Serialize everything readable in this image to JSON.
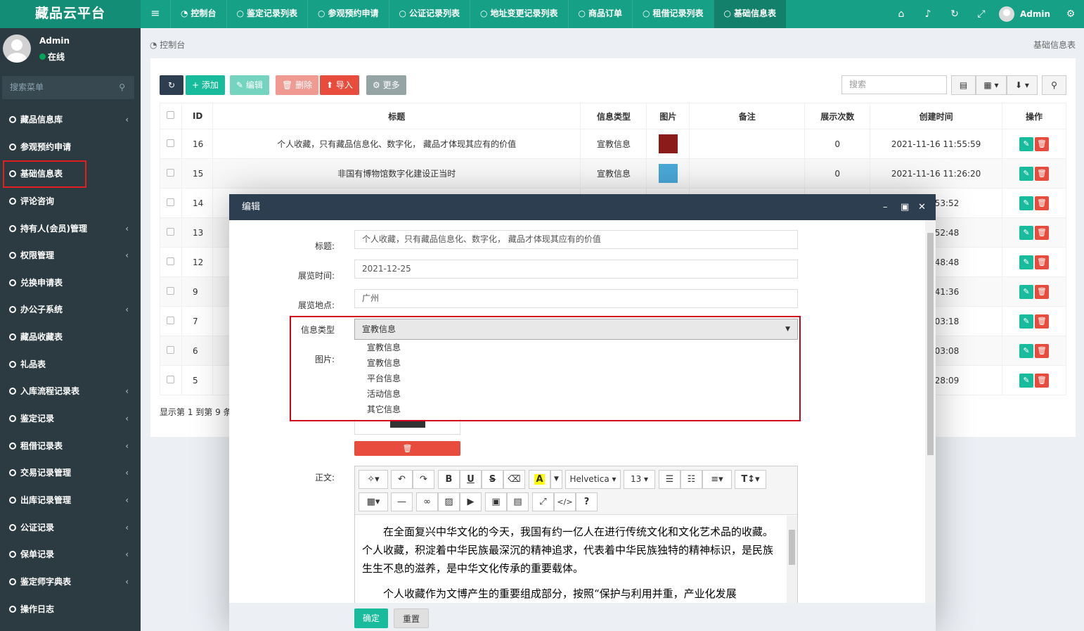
{
  "app": {
    "logo": "藏品云平台",
    "toggle_icon": "menu-icon"
  },
  "topnav": {
    "tabs": [
      {
        "label": "控制台",
        "icon": "dashboard-icon"
      },
      {
        "label": "鉴定记录列表",
        "icon": "circle-icon"
      },
      {
        "label": "参观预约申请",
        "icon": "circle-icon"
      },
      {
        "label": "公证记录列表",
        "icon": "circle-icon"
      },
      {
        "label": "地址变更记录列表",
        "icon": "circle-icon"
      },
      {
        "label": "商品订单",
        "icon": "circle-icon"
      },
      {
        "label": "租借记录列表",
        "icon": "circle-icon"
      },
      {
        "label": "基础信息表",
        "icon": "circle-icon",
        "active": true
      }
    ],
    "icons": [
      "home-icon",
      "bell-icon",
      "refresh-icon",
      "fullscreen-icon"
    ],
    "admin": "Admin"
  },
  "sidebar": {
    "user": "Admin",
    "status": "在线",
    "search_placeholder": "搜索菜单",
    "items": [
      {
        "label": "藏品信息库",
        "arrow": true
      },
      {
        "label": "参观预约申请",
        "arrow": false
      },
      {
        "label": "基础信息表",
        "arrow": false,
        "highlight": true
      },
      {
        "label": "评论咨询",
        "arrow": false
      },
      {
        "label": "持有人(会员)管理",
        "arrow": true
      },
      {
        "label": "权限管理",
        "arrow": true
      },
      {
        "label": "兑换申请表",
        "arrow": false
      },
      {
        "label": "办公子系统",
        "arrow": true
      },
      {
        "label": "藏品收藏表",
        "arrow": false
      },
      {
        "label": "礼品表",
        "arrow": false
      },
      {
        "label": "入库流程记录表",
        "arrow": true
      },
      {
        "label": "鉴定记录",
        "arrow": true
      },
      {
        "label": "租借记录表",
        "arrow": true
      },
      {
        "label": "交易记录管理",
        "arrow": true
      },
      {
        "label": "出库记录管理",
        "arrow": true
      },
      {
        "label": "公证记录",
        "arrow": true
      },
      {
        "label": "保单记录",
        "arrow": true
      },
      {
        "label": "鉴定师字典表",
        "arrow": true
      },
      {
        "label": "操作日志",
        "arrow": false
      }
    ]
  },
  "breadcrumb": {
    "left": "控制台",
    "right": "基础信息表"
  },
  "toolbar": {
    "add": "添加",
    "edit": "编辑",
    "delete": "删除",
    "import": "导入",
    "more": "更多",
    "search_placeholder": "搜索"
  },
  "table": {
    "headers": [
      "ID",
      "标题",
      "信息类型",
      "图片",
      "备注",
      "展示次数",
      "创建时间",
      "操作"
    ],
    "rows": [
      {
        "id": "16",
        "title": "个人收藏，只有藏品信息化、数字化， 藏品才体现其应有的价值",
        "type": "宣教信息",
        "views": "0",
        "time": "2021-11-16 11:55:59",
        "img": "#8b1a1a"
      },
      {
        "id": "15",
        "title": "非国有博物馆数字化建设正当时",
        "type": "宣教信息",
        "views": "0",
        "time": "2021-11-16 11:26:20",
        "img": "#4aa8d8"
      },
      {
        "id": "14",
        "title": "",
        "type": "",
        "views": "",
        "time": "6 10:53:52",
        "img": ""
      },
      {
        "id": "13",
        "title": "",
        "type": "",
        "views": "",
        "time": "0 14:52:48",
        "img": ""
      },
      {
        "id": "12",
        "title": "",
        "type": "",
        "views": "",
        "time": "0 14:48:48",
        "img": ""
      },
      {
        "id": "9",
        "title": "",
        "type": "",
        "views": "",
        "time": "1 14:41:36",
        "img": ""
      },
      {
        "id": "7",
        "title": "",
        "type": "",
        "views": "",
        "time": "7 20:03:18",
        "img": ""
      },
      {
        "id": "6",
        "title": "",
        "type": "",
        "views": "",
        "time": "7 20:03:08",
        "img": ""
      },
      {
        "id": "5",
        "title": "",
        "type": "",
        "views": "",
        "time": "6 20:28:09",
        "img": ""
      }
    ],
    "footer": "显示第 1 到第 9 条"
  },
  "modal": {
    "title": "编辑",
    "fields": {
      "title_label": "标题:",
      "title_value": "个人收藏，只有藏品信息化、数字化， 藏品才体现其应有的价值",
      "date_label": "展览时间:",
      "date_value": "2021-12-25",
      "place_label": "展览地点:",
      "place_value": "广州",
      "type_label": "信息类型",
      "type_value": "宣教信息",
      "image_label": "图片:",
      "body_label": "正文:"
    },
    "options": [
      "宣教信息",
      "宣教信息",
      "平台信息",
      "活动信息",
      "其它信息"
    ],
    "editor": {
      "font": "Helvetica",
      "size": "13",
      "paragraphs": [
        "在全面复兴中华文化的今天，我国有约一亿人在进行传统文化和文化艺术品的收藏。个人收藏，积淀着中华民族最深沉的精神追求，代表着中华民族独特的精神标识，是民族生生不息的滋养，是中华文化传承的重要载体。",
        "个人收藏作为文博产生的重要组成部分，按照“保护与利用并重，产业化发展"
      ]
    },
    "ok": "确定",
    "reset": "重置"
  },
  "colors": {
    "brand": "#16a085",
    "sidebar": "#2c3b41",
    "danger": "#e74c3c",
    "highlight": "#d0021b"
  }
}
